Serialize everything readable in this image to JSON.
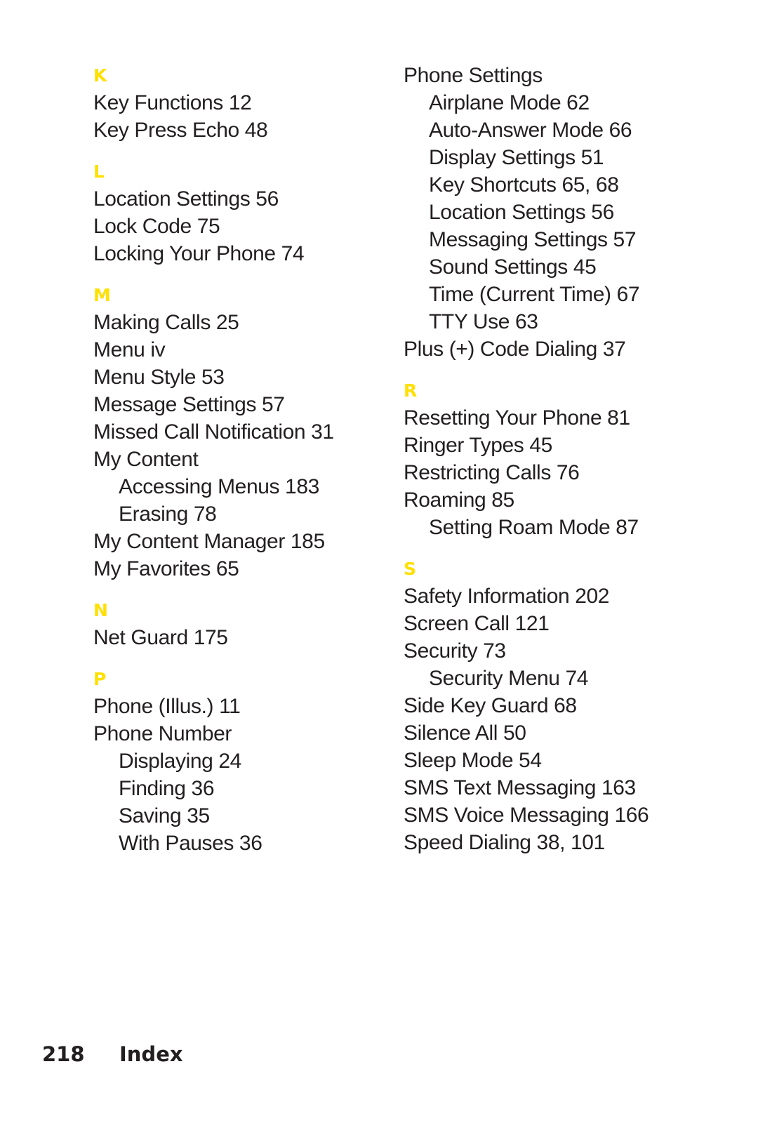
{
  "document": {
    "type": "index-page",
    "heading_color": "#ffe000",
    "text_color": "#231f20",
    "background_color": "#ffffff"
  },
  "columns": [
    {
      "name": "left-column",
      "sections": [
        {
          "letter": "K",
          "entries": [
            {
              "text": "Key Functions 12",
              "level": 1
            },
            {
              "text": "Key Press Echo 48",
              "level": 1
            }
          ]
        },
        {
          "letter": "L",
          "entries": [
            {
              "text": "Location Settings 56",
              "level": 1
            },
            {
              "text": "Lock Code 75",
              "level": 1
            },
            {
              "text": "Locking Your Phone 74",
              "level": 1
            }
          ]
        },
        {
          "letter": "M",
          "entries": [
            {
              "text": "Making Calls 25",
              "level": 1
            },
            {
              "text": "Menu iv",
              "level": 1
            },
            {
              "text": "Menu Style 53",
              "level": 1
            },
            {
              "text": "Message Settings 57",
              "level": 1
            },
            {
              "text": "Missed Call Notification 31",
              "level": 1
            },
            {
              "text": "My Content",
              "level": 1
            },
            {
              "text": "Accessing Menus 183",
              "level": 2
            },
            {
              "text": "Erasing 78",
              "level": 2
            },
            {
              "text": "My Content Manager 185",
              "level": 1
            },
            {
              "text": "My Favorites 65",
              "level": 1
            }
          ]
        },
        {
          "letter": "N",
          "entries": [
            {
              "text": "Net Guard 175",
              "level": 1
            }
          ]
        },
        {
          "letter": "P",
          "entries": [
            {
              "text": "Phone (Illus.) 11",
              "level": 1
            },
            {
              "text": "Phone Number",
              "level": 1
            },
            {
              "text": "Displaying 24",
              "level": 2
            },
            {
              "text": "Finding 36",
              "level": 2
            },
            {
              "text": "Saving 35",
              "level": 2
            },
            {
              "text": "With Pauses 36",
              "level": 2
            }
          ]
        }
      ]
    },
    {
      "name": "right-column",
      "sections": [
        {
          "letter": "",
          "entries": [
            {
              "text": "Phone Settings",
              "level": 1
            },
            {
              "text": "Airplane Mode 62",
              "level": 2
            },
            {
              "text": "Auto-Answer Mode 66",
              "level": 2
            },
            {
              "text": "Display Settings 51",
              "level": 2
            },
            {
              "text": "Key Shortcuts 65, 68",
              "level": 2
            },
            {
              "text": "Location Settings 56",
              "level": 2
            },
            {
              "text": "Messaging Settings 57",
              "level": 2
            },
            {
              "text": "Sound Settings 45",
              "level": 2
            },
            {
              "text": "Time (Current Time) 67",
              "level": 2
            },
            {
              "text": "TTY Use 63",
              "level": 2
            },
            {
              "text": "Plus (+) Code Dialing 37",
              "level": 1
            }
          ]
        },
        {
          "letter": "R",
          "entries": [
            {
              "text": "Resetting Your Phone 81",
              "level": 1
            },
            {
              "text": "Ringer Types 45",
              "level": 1
            },
            {
              "text": "Restricting Calls 76",
              "level": 1
            },
            {
              "text": "Roaming 85",
              "level": 1
            },
            {
              "text": "Setting Roam Mode 87",
              "level": 2
            }
          ]
        },
        {
          "letter": "S",
          "entries": [
            {
              "text": "Safety Information 202",
              "level": 1
            },
            {
              "text": "Screen Call 121",
              "level": 1
            },
            {
              "text": "Security 73",
              "level": 1
            },
            {
              "text": "Security Menu 74",
              "level": 2
            },
            {
              "text": "Side Key Guard 68",
              "level": 1
            },
            {
              "text": "Silence All 50",
              "level": 1
            },
            {
              "text": "Sleep Mode 54",
              "level": 1
            },
            {
              "text": "SMS Text Messaging 163",
              "level": 1
            },
            {
              "text": "SMS Voice Messaging 166",
              "level": 1
            },
            {
              "text": "Speed Dialing 38, 101",
              "level": 1
            }
          ]
        }
      ]
    }
  ],
  "footer": {
    "page_number": "218",
    "label": "Index"
  }
}
